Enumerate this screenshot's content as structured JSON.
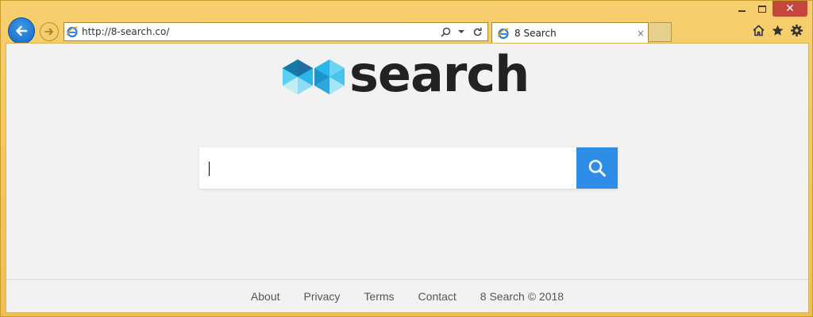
{
  "browser": {
    "address_url": "http://8-search.co/",
    "tab_title": "8 Search",
    "tab_close": "×",
    "window_close": "✕"
  },
  "page": {
    "logo_text": "search",
    "search": {
      "value": "",
      "placeholder": ""
    },
    "footer": {
      "links": [
        "About",
        "Privacy",
        "Terms",
        "Contact"
      ],
      "copyright": "8 Search © 2018"
    }
  },
  "colors": {
    "frame": "#f2c25a",
    "accent_blue": "#2e8de6",
    "logo_cyan": "#29b6e8"
  }
}
